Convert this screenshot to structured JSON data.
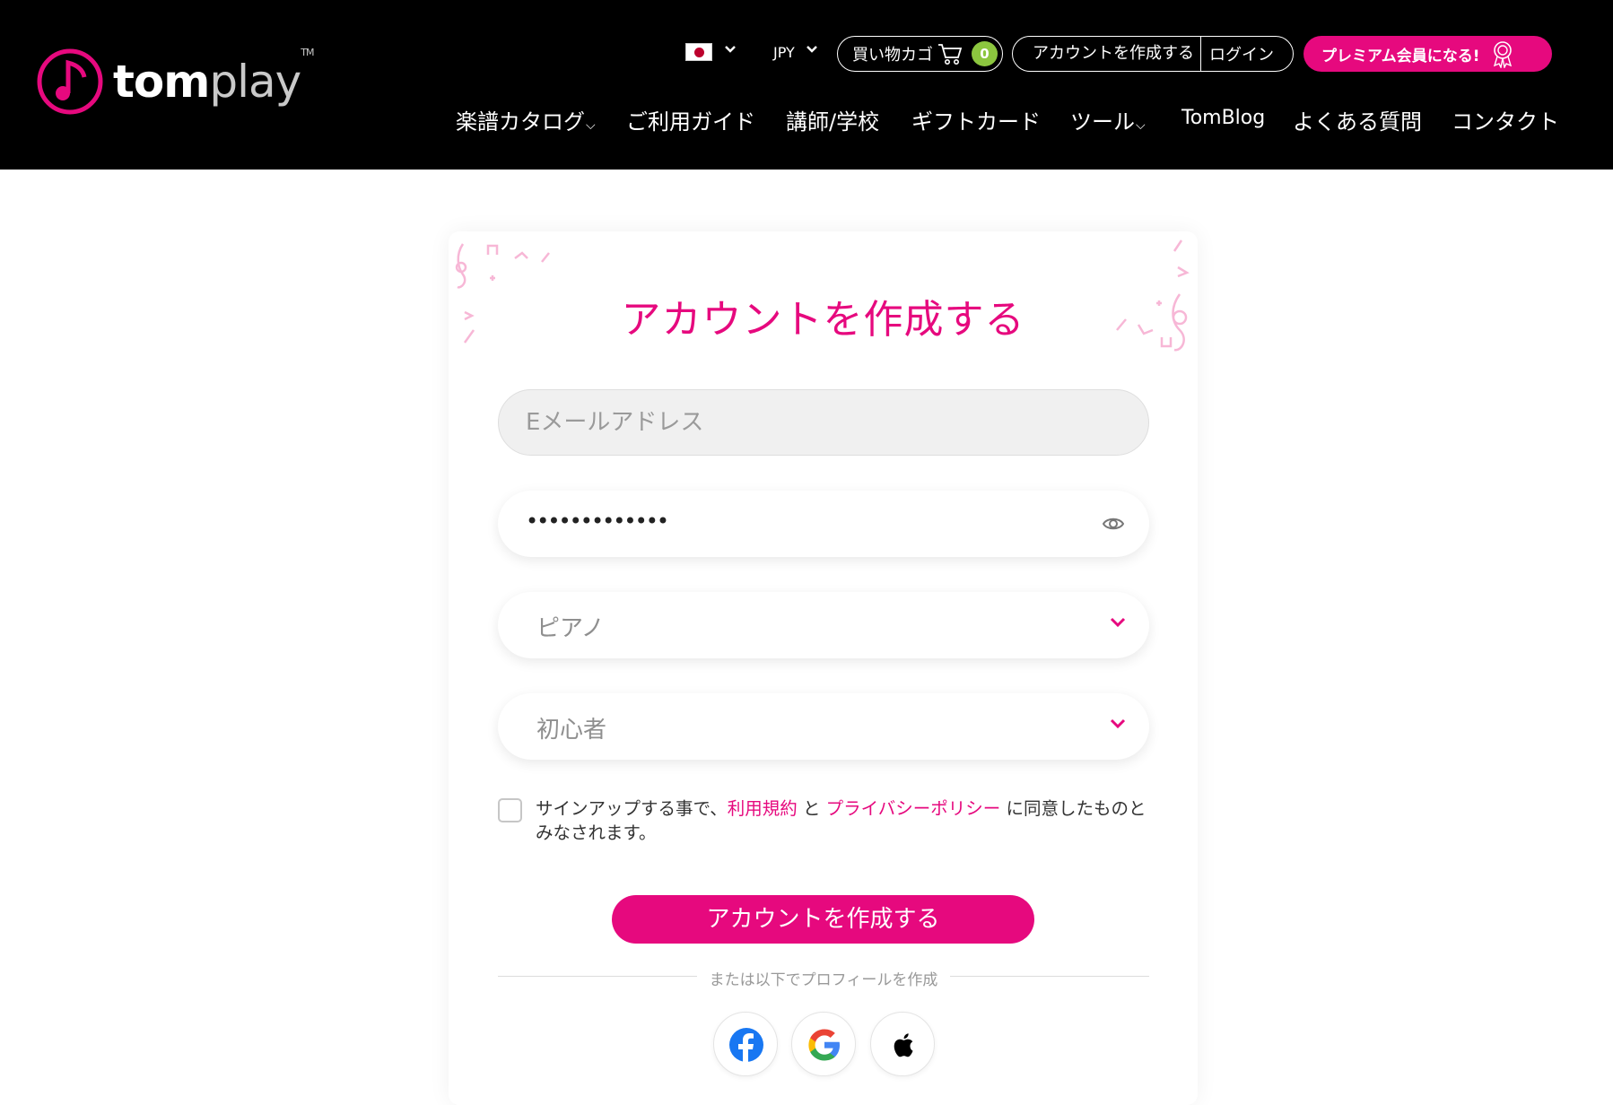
{
  "header": {
    "logo_text_bold": "tom",
    "logo_text_light": "play",
    "logo_tm": "TM",
    "currency": "JPY",
    "cart_label": "買い物カゴ",
    "cart_count": "0",
    "create_account_label": "アカウントを作成する",
    "login_label": "ログイン",
    "premium_label": "プレミアム会員になる!"
  },
  "nav": {
    "items": [
      {
        "label": "楽譜カタログ",
        "dropdown": true
      },
      {
        "label": "ご利用ガイド"
      },
      {
        "label": "講師/学校"
      },
      {
        "label": "ギフトカード"
      },
      {
        "label": "ツール",
        "dropdown": true
      },
      {
        "label": "TomBlog"
      },
      {
        "label": "よくある質問"
      },
      {
        "label": "コンタクト"
      }
    ]
  },
  "form": {
    "title": "アカウントを作成する",
    "email_placeholder": "Eメールアドレス",
    "password_value": "•••••••••••••",
    "instrument_value": "ピアノ",
    "level_value": "初心者",
    "agree_prefix": "サインアップする事で、",
    "terms_link": "利用規約",
    "agree_and": " と ",
    "privacy_link": "プライバシーポリシー",
    "agree_suffix": " に同意したものとみなされます。",
    "submit_label": "アカウントを作成する",
    "divider_text": "または以下でプロフィールを作成"
  },
  "colors": {
    "brand": "#e6097e",
    "cart_badge": "#8cc63f",
    "header_bg": "#000000"
  },
  "icons": [
    "flag-japan-icon",
    "chevron-down-icon",
    "cart-icon",
    "award-icon",
    "eye-icon",
    "facebook-icon",
    "google-icon",
    "apple-icon"
  ]
}
